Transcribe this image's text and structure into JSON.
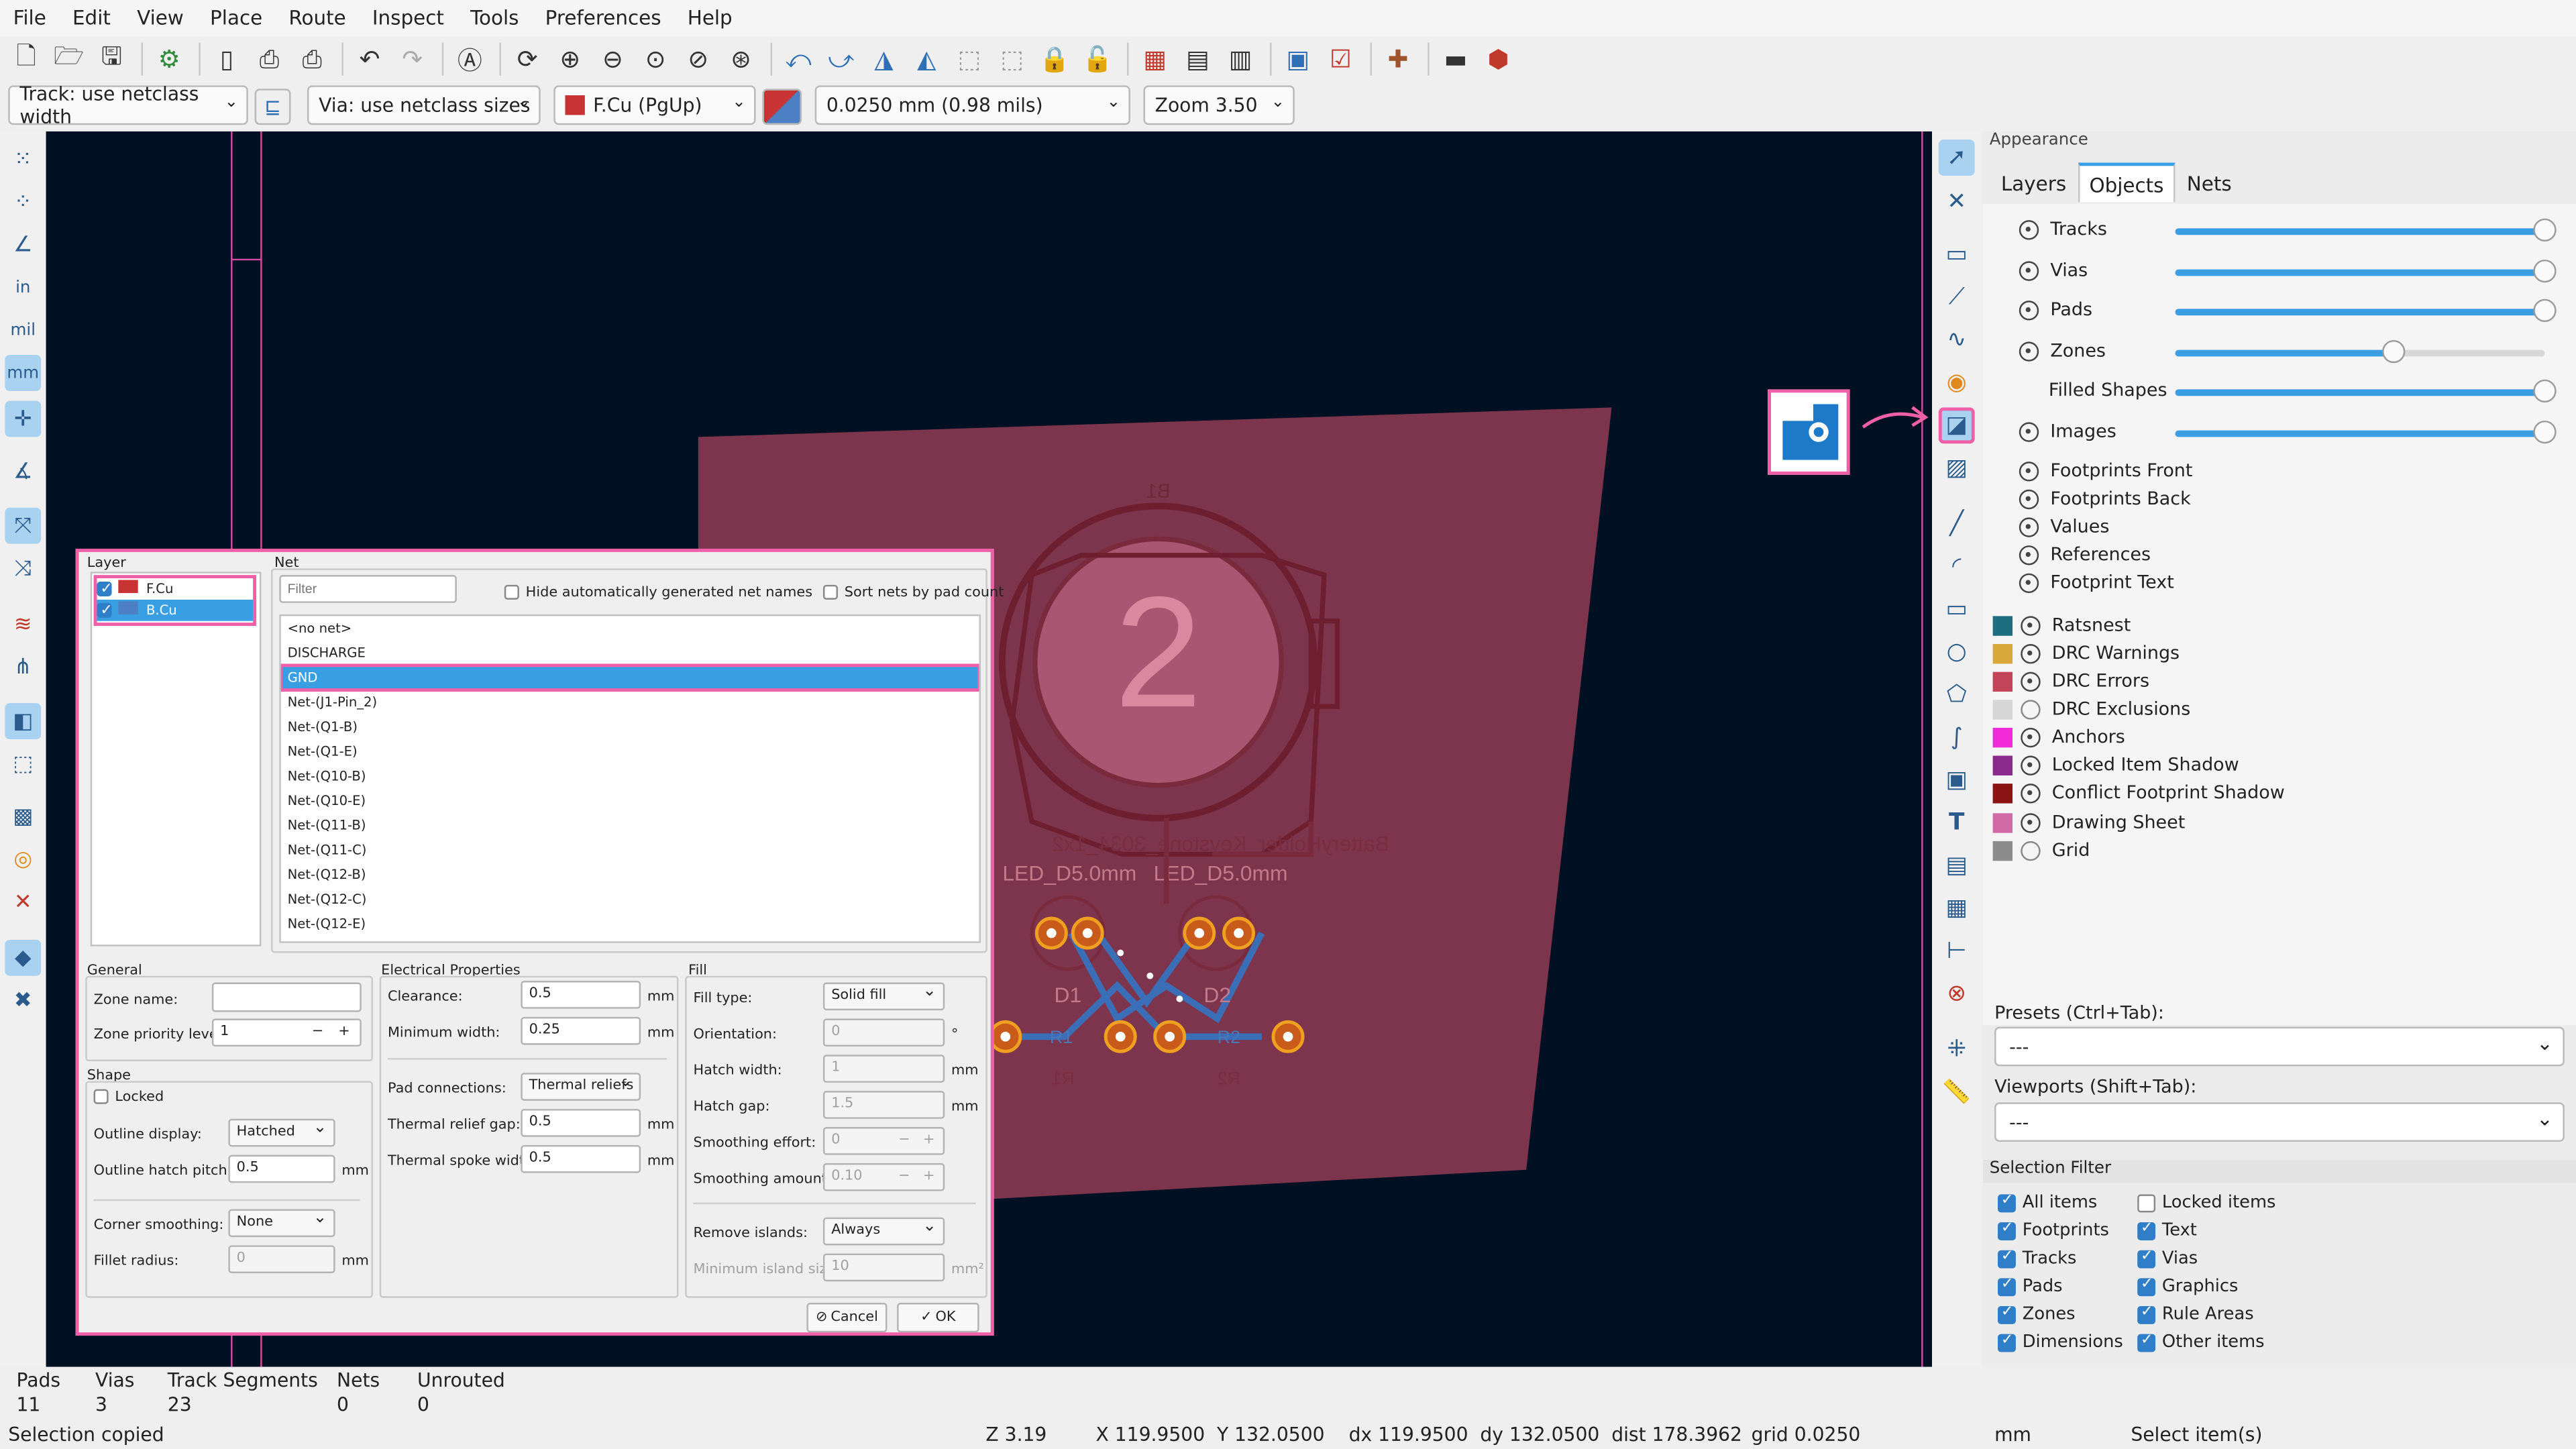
{
  "menu": [
    "File",
    "Edit",
    "View",
    "Place",
    "Route",
    "Inspect",
    "Tools",
    "Preferences",
    "Help"
  ],
  "top_toolbar_icons": [
    "new-board",
    "open",
    "save",
    "board-setup",
    "page-settings",
    "print",
    "plot",
    "undo",
    "redo",
    "find",
    "refresh",
    "zoom-in",
    "zoom-out",
    "zoom-fit",
    "zoom-objects",
    "rotate-ccw",
    "rotate-cw",
    "flip",
    "mirror",
    "group",
    "ungroup",
    "lock",
    "unlock",
    "netlist",
    "footprint-browser",
    "3d-viewer",
    "netlist-update",
    "drc",
    "scripting",
    "console",
    "plugin"
  ],
  "toolbar2": {
    "track": "Track: use netclass width",
    "via": "Via: use netclass sizes",
    "layer": "F.Cu (PgUp)",
    "grid": "0.0250 mm (0.98 mils)",
    "zoom": "Zoom 3.50"
  },
  "canvas": {
    "pad_number": "2",
    "ref_b1": "B1",
    "battery_label": "BatteryHolder_Keystone_3034_1x2",
    "led_label_1": "LED_D5.0mm",
    "led_label_2": "LED_D5.0mm",
    "d1": "D1",
    "d2": "D2",
    "r1_front": "R1",
    "r2_front": "R2",
    "r1_back": "R1",
    "r2_back": "R2"
  },
  "dialog": {
    "layer_header": "Layer",
    "layers": [
      {
        "name": "F.Cu",
        "color": "#c83434",
        "checked": true
      },
      {
        "name": "B.Cu",
        "color": "#4d7fc4",
        "checked": true
      }
    ],
    "net_header": "Net",
    "filter_placeholder": "Filter",
    "hide_auto_label": "Hide automatically generated net names",
    "sort_label": "Sort nets by pad count",
    "nets": [
      "<no net>",
      "DISCHARGE",
      "GND",
      "Net-(J1-Pin_2)",
      "Net-(Q1-B)",
      "Net-(Q1-E)",
      "Net-(Q10-B)",
      "Net-(Q10-E)",
      "Net-(Q11-B)",
      "Net-(Q11-C)",
      "Net-(Q12-B)",
      "Net-(Q12-C)",
      "Net-(Q12-E)"
    ],
    "selected_net": "GND",
    "general": {
      "title": "General",
      "zone_name_label": "Zone name:",
      "zone_name_value": "",
      "priority_label": "Zone priority level:",
      "priority_value": "1"
    },
    "shape": {
      "title": "Shape",
      "locked_label": "Locked",
      "outline_display_label": "Outline display:",
      "outline_display_value": "Hatched",
      "hatch_pitch_label": "Outline hatch pitch:",
      "hatch_pitch_value": "0.5",
      "hatch_pitch_unit": "mm",
      "corner_label": "Corner smoothing:",
      "corner_value": "None",
      "fillet_label": "Fillet radius:",
      "fillet_value": "0",
      "fillet_unit": "mm"
    },
    "electrical": {
      "title": "Electrical Properties",
      "clearance_label": "Clearance:",
      "clearance_value": "0.5",
      "clearance_unit": "mm",
      "min_width_label": "Minimum width:",
      "min_width_value": "0.25",
      "min_width_unit": "mm",
      "pad_conn_label": "Pad connections:",
      "pad_conn_value": "Thermal reliefs",
      "relief_gap_label": "Thermal relief gap:",
      "relief_gap_value": "0.5",
      "relief_gap_unit": "mm",
      "spoke_label": "Thermal spoke width:",
      "spoke_value": "0.5",
      "spoke_unit": "mm"
    },
    "fill": {
      "title": "Fill",
      "fill_type_label": "Fill type:",
      "fill_type_value": "Solid fill",
      "orientation_label": "Orientation:",
      "orientation_value": "0",
      "orientation_unit": "°",
      "hatch_width_label": "Hatch width:",
      "hatch_width_value": "1",
      "hatch_width_unit": "mm",
      "hatch_gap_label": "Hatch gap:",
      "hatch_gap_value": "1.5",
      "hatch_gap_unit": "mm",
      "smooth_effort_label": "Smoothing effort:",
      "smooth_effort_value": "0",
      "smooth_amount_label": "Smoothing amount:",
      "smooth_amount_value": "0.10",
      "remove_islands_label": "Remove islands:",
      "remove_islands_value": "Always",
      "min_island_label": "Minimum island size:",
      "min_island_value": "10",
      "min_island_unit": "mm²"
    },
    "cancel": "Cancel",
    "ok": "OK"
  },
  "appearance": {
    "title": "Appearance",
    "tabs": [
      "Layers",
      "Objects",
      "Nets"
    ],
    "active_tab": "Objects",
    "objects": [
      {
        "name": "Tracks",
        "visible": true,
        "opacity": 1.0
      },
      {
        "name": "Vias",
        "visible": true,
        "opacity": 1.0
      },
      {
        "name": "Pads",
        "visible": true,
        "opacity": 1.0
      },
      {
        "name": "Zones",
        "visible": true,
        "opacity": 0.6
      },
      {
        "name": "Filled Shapes",
        "visible": null,
        "opacity": 1.0
      },
      {
        "name": "Images",
        "visible": true,
        "opacity": 1.0
      }
    ],
    "footprint_items": [
      "Footprints Front",
      "Footprints Back",
      "Values",
      "References",
      "Footprint Text"
    ],
    "colored_items": [
      {
        "name": "Ratsnest",
        "color": "#1d6f7f",
        "visible": true
      },
      {
        "name": "DRC Warnings",
        "color": "#d8a93a",
        "visible": true
      },
      {
        "name": "DRC Errors",
        "color": "#c2455a",
        "visible": true
      },
      {
        "name": "DRC Exclusions",
        "color": "#d6d6d6",
        "visible": false
      },
      {
        "name": "Anchors",
        "color": "#f02ad6",
        "visible": true
      },
      {
        "name": "Locked Item Shadow",
        "color": "#8a2a8c",
        "visible": true
      },
      {
        "name": "Conflict Footprint Shadow",
        "color": "#8a1414",
        "visible": true
      },
      {
        "name": "Drawing Sheet",
        "color": "#d26aa8",
        "visible": true
      },
      {
        "name": "Grid",
        "color": "#8c8c8c",
        "visible": false
      }
    ],
    "presets_label": "Presets (Ctrl+Tab):",
    "presets_value": "---",
    "viewports_label": "Viewports (Shift+Tab):",
    "viewports_value": "---",
    "selection_filter_title": "Selection Filter",
    "selection_filter": [
      {
        "name": "All items",
        "checked": true
      },
      {
        "name": "Locked items",
        "checked": false
      },
      {
        "name": "Footprints",
        "checked": true
      },
      {
        "name": "Text",
        "checked": true
      },
      {
        "name": "Tracks",
        "checked": true
      },
      {
        "name": "Vias",
        "checked": true
      },
      {
        "name": "Pads",
        "checked": true
      },
      {
        "name": "Graphics",
        "checked": true
      },
      {
        "name": "Zones",
        "checked": true
      },
      {
        "name": "Rule Areas",
        "checked": true
      },
      {
        "name": "Dimensions",
        "checked": true
      },
      {
        "name": "Other items",
        "checked": true
      }
    ]
  },
  "msgbar": {
    "labels": [
      "Pads",
      "Vias",
      "Track Segments",
      "Nets",
      "Unrouted"
    ],
    "values": [
      "11",
      "3",
      "23",
      "0",
      "0"
    ]
  },
  "status": {
    "message": "Selection copied",
    "zoom": "Z 3.19",
    "xy": "X 119.9500  Y 132.0500",
    "delta": "dx 119.9500  dy 132.0500  dist 178.3962",
    "grid": "grid 0.0250",
    "units": "mm",
    "mode": "Select item(s)"
  }
}
